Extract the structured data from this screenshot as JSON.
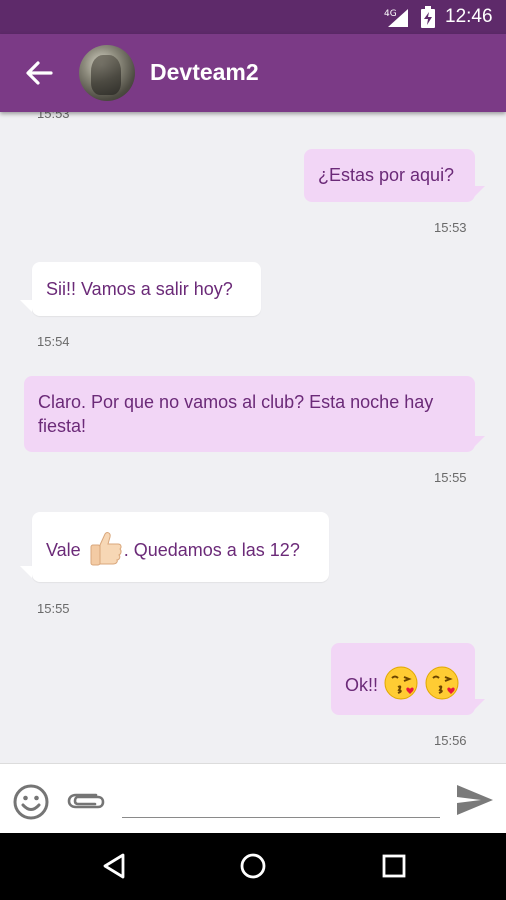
{
  "status_bar": {
    "network_label": "4G",
    "time": "12:46"
  },
  "header": {
    "contact_name": "Devteam2"
  },
  "conversation": {
    "clipped_timestamp": "15:53",
    "messages": [
      {
        "direction": "outgoing",
        "text": "¿Estas por aqui?",
        "time": "15:53"
      },
      {
        "direction": "incoming",
        "text": "Sii!! Vamos a salir hoy?",
        "time": "15:54"
      },
      {
        "direction": "outgoing",
        "text_line1": "Claro. Por que no vamos al club? Esta noche hay",
        "text_line2": "fiesta!",
        "time": "15:55"
      },
      {
        "direction": "incoming",
        "text_before_emoji": "Vale",
        "emoji": "thumbs-up",
        "text_after_emoji": ". Quedamos a las 12?",
        "time": "15:55"
      },
      {
        "direction": "outgoing",
        "text": "Ok!!",
        "emoji": "face-blowing-kiss",
        "emoji_count": 2,
        "time": "15:56"
      }
    ]
  },
  "composer": {
    "input_value": "",
    "input_placeholder": ""
  },
  "colors": {
    "status_bar": "#5e2a6a",
    "app_bar": "#7b3a86",
    "outgoing_bubble": "#f2d6f6",
    "incoming_bubble": "#ffffff",
    "message_text": "#6b2a78",
    "chat_background": "#f0f0f3"
  }
}
